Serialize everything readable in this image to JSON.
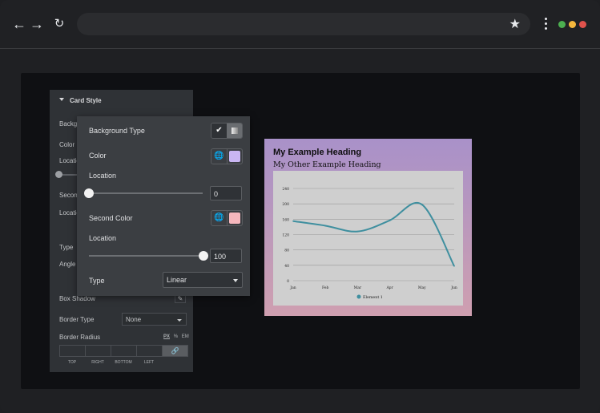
{
  "browser": {
    "url": "",
    "icons": {
      "back": "arrow-left-icon",
      "forward": "arrow-right-icon",
      "reload": "reload-icon",
      "star": "star-icon",
      "menu": "kebab-menu-icon"
    },
    "dots": [
      "#4caf50",
      "#f5b83d",
      "#e0524c"
    ]
  },
  "back_panel": {
    "section_title": "Card Style",
    "labels": {
      "background": "Backgro",
      "color": "Color",
      "location": "Locatio",
      "second_color": "Second",
      "second_location": "Locatio",
      "type": "Type",
      "angle": "Angle",
      "box_shadow": "Box Shadow",
      "border_type": "Border Type",
      "border_radius": "Border Radius"
    },
    "border_type_value": "None",
    "units": [
      "PX",
      "%",
      "EM"
    ],
    "radius_labels": [
      "TOP",
      "RIGHT",
      "BOTTOM",
      "LEFT"
    ]
  },
  "popup": {
    "background_type_label": "Background Type",
    "color_label": "Color",
    "color_value": "#c9b6f2",
    "location_label": "Location",
    "location_value": "0",
    "second_color_label": "Second Color",
    "second_color_value": "#f6b7bd",
    "second_location_label": "Location",
    "second_location_value": "100",
    "type_label": "Type",
    "type_value": "Linear"
  },
  "card": {
    "heading": "My Example Heading",
    "subheading": "My Other Example Heading"
  },
  "chart_data": {
    "type": "line",
    "categories": [
      "Jan",
      "Feb",
      "Mar",
      "Apr",
      "May",
      "Jun"
    ],
    "series": [
      {
        "name": "Element 1",
        "values": [
          155,
          143,
          128,
          157,
          198,
          38
        ]
      }
    ],
    "ylim": [
      0,
      240
    ],
    "yticks": [
      0,
      40,
      80,
      120,
      160,
      200,
      240
    ],
    "line_color": "#3f8f9f",
    "grid": true,
    "legend_position": "bottom"
  }
}
